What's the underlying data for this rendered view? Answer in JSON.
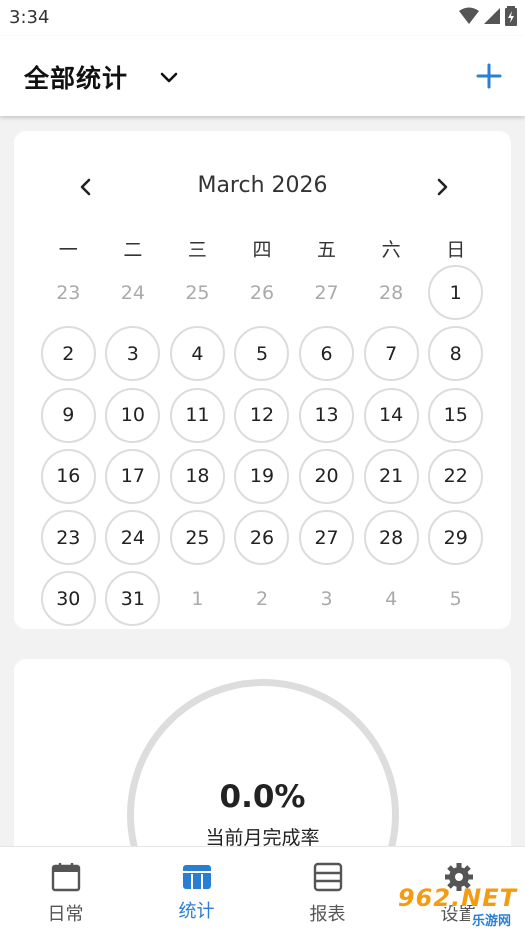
{
  "status_bar": {
    "time": "3:34"
  },
  "app_bar": {
    "title": "全部统计"
  },
  "calendar": {
    "title": "March 2026",
    "weekdays": [
      "一",
      "二",
      "三",
      "四",
      "五",
      "六",
      "日"
    ],
    "days": [
      {
        "label": "23",
        "current": false
      },
      {
        "label": "24",
        "current": false
      },
      {
        "label": "25",
        "current": false
      },
      {
        "label": "26",
        "current": false
      },
      {
        "label": "27",
        "current": false
      },
      {
        "label": "28",
        "current": false
      },
      {
        "label": "1",
        "current": true
      },
      {
        "label": "2",
        "current": true
      },
      {
        "label": "3",
        "current": true
      },
      {
        "label": "4",
        "current": true
      },
      {
        "label": "5",
        "current": true
      },
      {
        "label": "6",
        "current": true
      },
      {
        "label": "7",
        "current": true
      },
      {
        "label": "8",
        "current": true
      },
      {
        "label": "9",
        "current": true
      },
      {
        "label": "10",
        "current": true
      },
      {
        "label": "11",
        "current": true
      },
      {
        "label": "12",
        "current": true
      },
      {
        "label": "13",
        "current": true
      },
      {
        "label": "14",
        "current": true
      },
      {
        "label": "15",
        "current": true
      },
      {
        "label": "16",
        "current": true
      },
      {
        "label": "17",
        "current": true
      },
      {
        "label": "18",
        "current": true
      },
      {
        "label": "19",
        "current": true
      },
      {
        "label": "20",
        "current": true
      },
      {
        "label": "21",
        "current": true
      },
      {
        "label": "22",
        "current": true
      },
      {
        "label": "23",
        "current": true
      },
      {
        "label": "24",
        "current": true
      },
      {
        "label": "25",
        "current": true
      },
      {
        "label": "26",
        "current": true
      },
      {
        "label": "27",
        "current": true
      },
      {
        "label": "28",
        "current": true
      },
      {
        "label": "29",
        "current": true
      },
      {
        "label": "30",
        "current": true
      },
      {
        "label": "31",
        "current": true
      },
      {
        "label": "1",
        "current": false
      },
      {
        "label": "2",
        "current": false
      },
      {
        "label": "3",
        "current": false
      },
      {
        "label": "4",
        "current": false
      },
      {
        "label": "5",
        "current": false
      }
    ]
  },
  "stats": {
    "rate_value": "0.0%",
    "rate_label": "当前月完成率",
    "rate_fraction": 0.0
  },
  "bottom_nav": {
    "items": [
      {
        "label": "日常",
        "icon": "calendar-icon",
        "active": false
      },
      {
        "label": "统计",
        "icon": "stats-icon",
        "active": true
      },
      {
        "label": "报表",
        "icon": "report-icon",
        "active": false
      },
      {
        "label": "设置",
        "icon": "gear-icon",
        "active": false
      }
    ]
  },
  "watermark": {
    "text": "962.NET",
    "subtext": "乐游网"
  },
  "colors": {
    "accent": "#2a7fd4",
    "inactive": "#555555",
    "circle_border": "#dcdcdc",
    "other_month": "#aaaaaa",
    "watermark": "#f39c12"
  }
}
